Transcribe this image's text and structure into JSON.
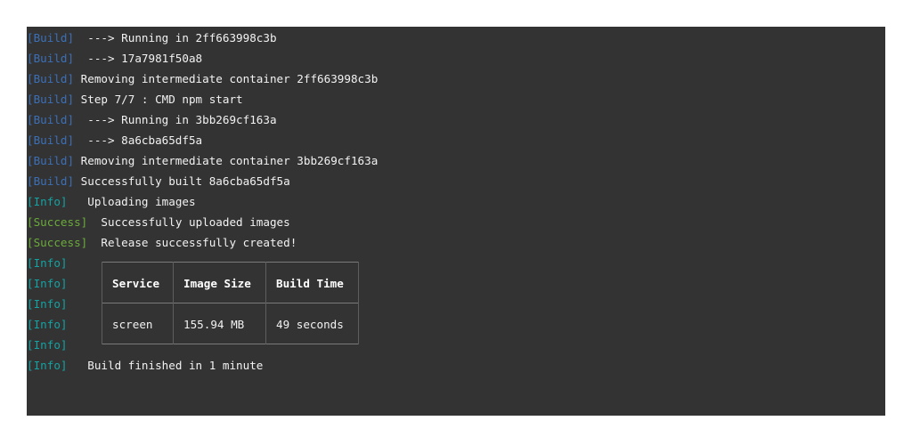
{
  "log": [
    {
      "tag": "[Build]",
      "kind": "build",
      "text": "  ---> Running in 2ff663998c3b"
    },
    {
      "tag": "[Build]",
      "kind": "build",
      "text": "  ---> 17a7981f50a8"
    },
    {
      "tag": "[Build]",
      "kind": "build",
      "text": " Removing intermediate container 2ff663998c3b"
    },
    {
      "tag": "[Build]",
      "kind": "build",
      "text": " Step 7/7 : CMD npm start"
    },
    {
      "tag": "[Build]",
      "kind": "build",
      "text": "  ---> Running in 3bb269cf163a"
    },
    {
      "tag": "[Build]",
      "kind": "build",
      "text": "  ---> 8a6cba65df5a"
    },
    {
      "tag": "[Build]",
      "kind": "build",
      "text": " Removing intermediate container 3bb269cf163a"
    },
    {
      "tag": "[Build]",
      "kind": "build",
      "text": " Successfully built 8a6cba65df5a"
    },
    {
      "tag": "[Info]",
      "kind": "info",
      "text": "   Uploading images"
    },
    {
      "tag": "[Success]",
      "kind": "success",
      "text": "  Successfully uploaded images"
    },
    {
      "tag": "[Success]",
      "kind": "success",
      "text": "  Release successfully created!"
    },
    {
      "tag": "[Info]",
      "kind": "info",
      "text": ""
    },
    {
      "tag": "[Info]",
      "kind": "info",
      "text": ""
    },
    {
      "tag": "[Info]",
      "kind": "info",
      "text": ""
    },
    {
      "tag": "[Info]",
      "kind": "info",
      "text": ""
    },
    {
      "tag": "[Info]",
      "kind": "info",
      "text": ""
    },
    {
      "tag": "[Info]",
      "kind": "info",
      "text": "   Build finished in 1 minute"
    }
  ],
  "table": {
    "headers": [
      "Service",
      "Image Size",
      "Build Time"
    ],
    "rows": [
      [
        "screen",
        "155.94 MB",
        "49 seconds"
      ]
    ]
  },
  "colors": {
    "background": "#333333",
    "build_tag": "#3b70b8",
    "info_tag": "#14a3a3",
    "success_tag": "#6bab3a",
    "text": "#f2f2f2"
  }
}
